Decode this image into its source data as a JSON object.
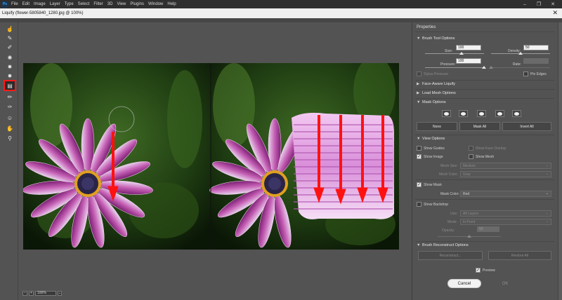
{
  "app": {
    "logo": "Ps",
    "menu": [
      "File",
      "Edit",
      "Image",
      "Layer",
      "Type",
      "Select",
      "Filter",
      "3D",
      "View",
      "Plugins",
      "Window",
      "Help"
    ],
    "window_controls": {
      "minimize": "–",
      "maximize": "❐",
      "close": "✕"
    }
  },
  "dialog": {
    "title": "Liquify (flower-5805840_1280.jpg @ 100%)",
    "close": "✕"
  },
  "tools": [
    {
      "name": "forward-warp-tool",
      "glyph": "☝"
    },
    {
      "name": "reconstruct-tool",
      "glyph": "✎"
    },
    {
      "name": "smooth-tool",
      "glyph": "✐"
    },
    {
      "name": "twirl-tool",
      "glyph": "✺"
    },
    {
      "name": "pucker-tool",
      "glyph": "✹"
    },
    {
      "name": "bloat-tool",
      "glyph": "✸"
    },
    {
      "name": "push-left-tool",
      "glyph": "▤",
      "active": true
    },
    {
      "name": "freeze-mask-tool",
      "glyph": "✏"
    },
    {
      "name": "thaw-mask-tool",
      "glyph": "✑"
    },
    {
      "name": "face-tool",
      "glyph": "☺"
    },
    {
      "name": "hand-tool",
      "glyph": "✋"
    },
    {
      "name": "zoom-tool",
      "glyph": "⚲"
    }
  ],
  "status": {
    "zoom_out": "−",
    "zoom_in": "+",
    "zoom": "100%",
    "zoom_menu": "⌄"
  },
  "properties": {
    "title": "Properties",
    "brush_tool_options": {
      "header": "Brush Tool Options",
      "size_label": "Size:",
      "size_value": "100",
      "density_label": "Density:",
      "density_value": "50",
      "pressure_label": "Pressure:",
      "pressure_value": "100",
      "rate_label": "Rate:",
      "rate_value": "",
      "stylus_label": "Stylus Pressure",
      "pin_edges_label": "Pin Edges",
      "size_fraction": 0.62,
      "density_fraction": 0.5,
      "pressure_fraction": 1.0,
      "rate_fraction": 0.0
    },
    "face_aware": {
      "header": "Face-Aware Liquify"
    },
    "load_mesh": {
      "header": "Load Mesh Options"
    },
    "mask_options": {
      "header": "Mask Options",
      "none_label": "None",
      "mask_all_label": "Mask All",
      "invert_all_label": "Invert All"
    },
    "view_options": {
      "header": "View Options",
      "show_guides_label": "Show Guides",
      "show_face_overlay_label": "Show Face Overlay",
      "show_image_label": "Show Image",
      "show_mesh_label": "Show Mesh",
      "mesh_size_label": "Mesh Size:",
      "mesh_size_value": "Medium",
      "mesh_color_label": "Mesh Color:",
      "mesh_color_value": "Gray",
      "show_mask_label": "Show Mask",
      "mask_color_label": "Mask Color:",
      "mask_color_value": "Red",
      "show_backdrop_label": "Show Backdrop",
      "use_label": "Use:",
      "use_value": "All Layers",
      "mode_label": "Mode:",
      "mode_value": "In Front",
      "opacity_label": "Opacity:",
      "opacity_value": "50",
      "opacity_fraction": 0.5
    },
    "brush_reconstruct": {
      "header": "Brush Reconstruct Options",
      "reconstruct_label": "Reconstruct...",
      "restore_all_label": "Restore All"
    },
    "preview_label": "Preview",
    "cancel_label": "Cancel",
    "ok_label": "OK"
  },
  "colors": {
    "active_tool_outline": "#ff1a1a",
    "arrow": "#ff1111",
    "petal": "#c060b0"
  }
}
